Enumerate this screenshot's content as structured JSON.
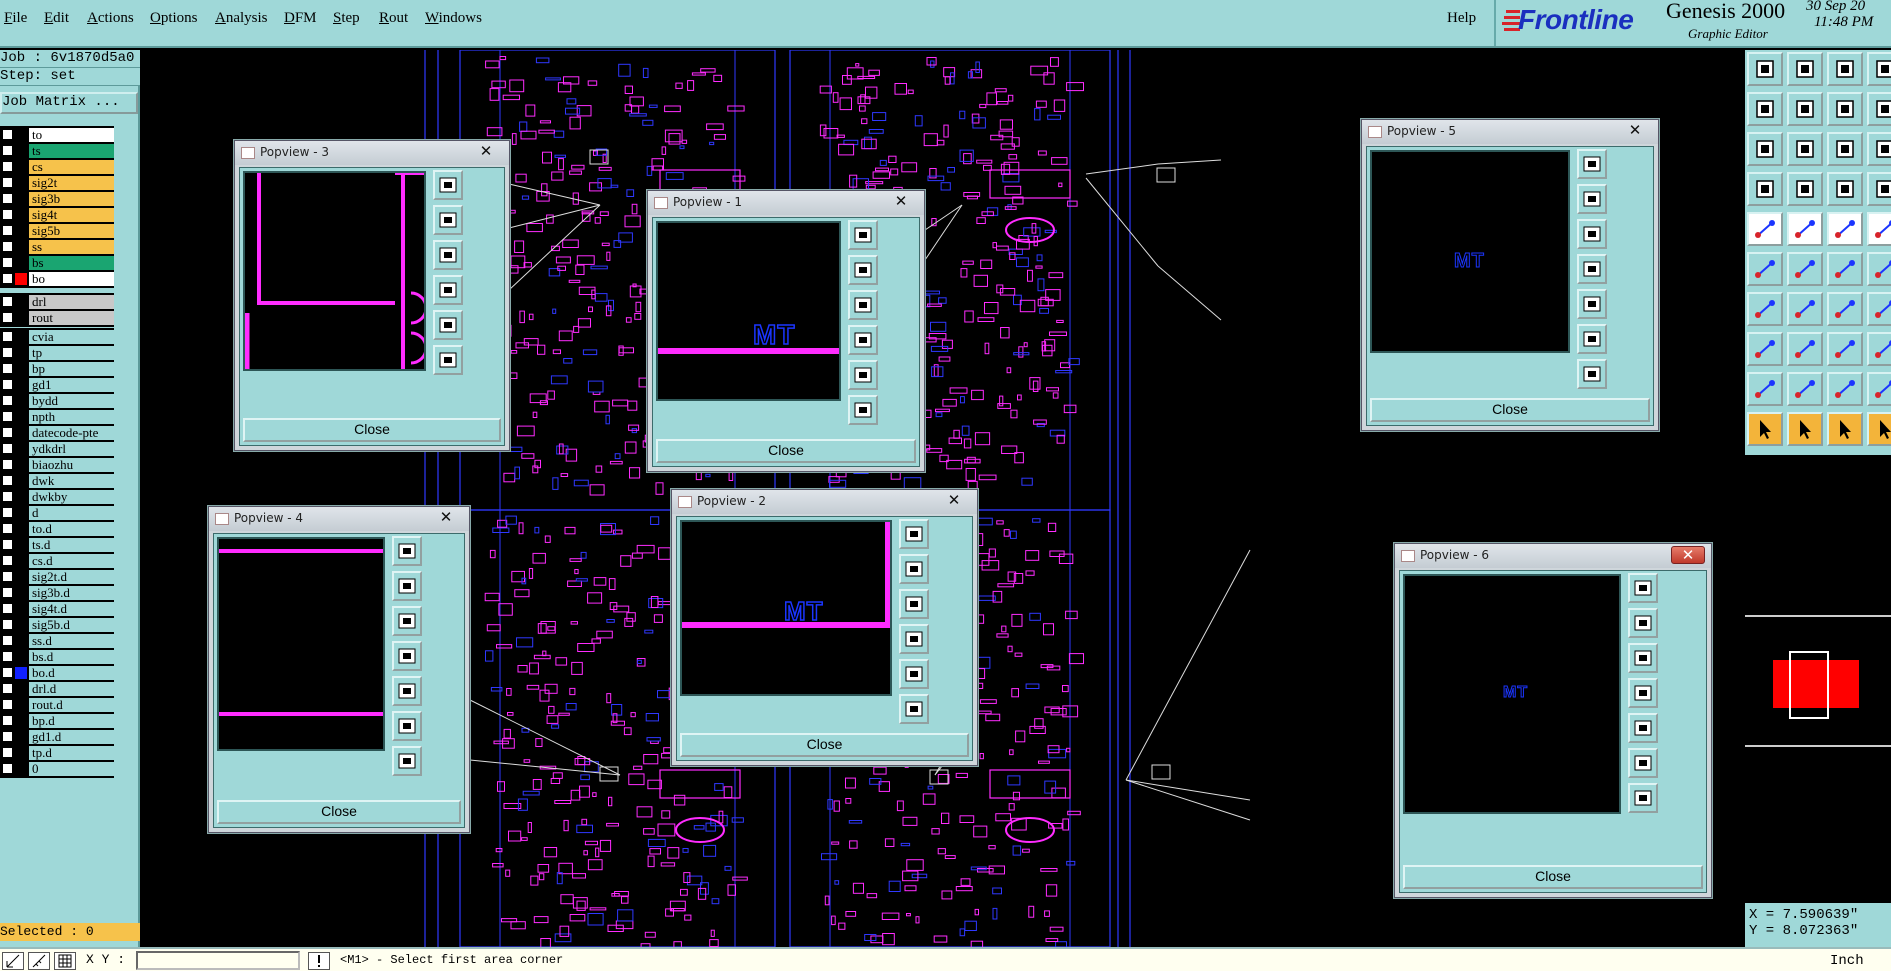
{
  "menubar": {
    "items": [
      "File",
      "Edit",
      "Actions",
      "Options",
      "Analysis",
      "DFM",
      "Step",
      "Rout",
      "Windows"
    ],
    "help": "Help"
  },
  "brand": {
    "logo": "Frontline",
    "title": "Genesis 2000",
    "subtitle": "Graphic Editor",
    "date": "30 Sep 20",
    "time": "11:48 PM"
  },
  "left_panel": {
    "job": "Job : 6v1870d5a0",
    "step": "Step: set",
    "job_matrix": "Job Matrix ...",
    "selected": "Selected : 0",
    "groups": [
      [
        {
          "name": "to",
          "color": "#ffffff",
          "flag": ""
        },
        {
          "name": "ts",
          "color": "#1aa571",
          "flag": ""
        },
        {
          "name": "cs",
          "color": "#f6c24b",
          "flag": ""
        },
        {
          "name": "sig2t",
          "color": "#f6c24b",
          "flag": ""
        },
        {
          "name": "sig3b",
          "color": "#f6c24b",
          "flag": ""
        },
        {
          "name": "sig4t",
          "color": "#f6c24b",
          "flag": ""
        },
        {
          "name": "sig5b",
          "color": "#f6c24b",
          "flag": ""
        },
        {
          "name": "ss",
          "color": "#f6c24b",
          "flag": ""
        },
        {
          "name": "bs",
          "color": "#1aa571",
          "flag": ""
        },
        {
          "name": "bo",
          "color": "#ffffff",
          "flag": "#ff0000"
        }
      ],
      [
        {
          "name": "drl",
          "color": "#c8c8c8",
          "flag": ""
        },
        {
          "name": "rout",
          "color": "#c8c8c8",
          "flag": ""
        }
      ],
      [
        {
          "name": "cvia",
          "color": "#9fd8d8",
          "flag": ""
        },
        {
          "name": "tp",
          "color": "#9fd8d8",
          "flag": ""
        },
        {
          "name": "bp",
          "color": "#9fd8d8",
          "flag": ""
        },
        {
          "name": "gd1",
          "color": "#9fd8d8",
          "flag": ""
        },
        {
          "name": "bydd",
          "color": "#9fd8d8",
          "flag": ""
        },
        {
          "name": "npth",
          "color": "#9fd8d8",
          "flag": ""
        },
        {
          "name": "datecode-pte",
          "color": "#9fd8d8",
          "flag": ""
        },
        {
          "name": "ydkdrl",
          "color": "#9fd8d8",
          "flag": ""
        },
        {
          "name": "biaozhu",
          "color": "#9fd8d8",
          "flag": ""
        },
        {
          "name": "dwk",
          "color": "#9fd8d8",
          "flag": ""
        },
        {
          "name": "dwkby",
          "color": "#9fd8d8",
          "flag": ""
        },
        {
          "name": "d",
          "color": "#9fd8d8",
          "flag": ""
        },
        {
          "name": "to.d",
          "color": "#9fd8d8",
          "flag": ""
        },
        {
          "name": "ts.d",
          "color": "#9fd8d8",
          "flag": ""
        },
        {
          "name": "cs.d",
          "color": "#9fd8d8",
          "flag": ""
        },
        {
          "name": "sig2t.d",
          "color": "#9fd8d8",
          "flag": ""
        },
        {
          "name": "sig3b.d",
          "color": "#9fd8d8",
          "flag": ""
        },
        {
          "name": "sig4t.d",
          "color": "#9fd8d8",
          "flag": ""
        },
        {
          "name": "sig5b.d",
          "color": "#9fd8d8",
          "flag": ""
        },
        {
          "name": "ss.d",
          "color": "#9fd8d8",
          "flag": ""
        },
        {
          "name": "bs.d",
          "color": "#9fd8d8",
          "flag": ""
        },
        {
          "name": "bo.d",
          "color": "#9fd8d8",
          "flag": "#1020ff"
        },
        {
          "name": "drl.d",
          "color": "#9fd8d8",
          "flag": ""
        },
        {
          "name": "rout.d",
          "color": "#9fd8d8",
          "flag": ""
        },
        {
          "name": "bp.d",
          "color": "#9fd8d8",
          "flag": ""
        },
        {
          "name": "gd1.d",
          "color": "#9fd8d8",
          "flag": ""
        },
        {
          "name": "tp.d",
          "color": "#9fd8d8",
          "flag": ""
        },
        {
          "name": "0",
          "color": "#9fd8d8",
          "flag": ""
        }
      ]
    ]
  },
  "popviews": [
    {
      "title": "Popview - 3",
      "close": "Close",
      "label": ""
    },
    {
      "title": "Popview - 1",
      "close": "Close",
      "label": "MT"
    },
    {
      "title": "Popview - 5",
      "close": "Close",
      "label": "MT"
    },
    {
      "title": "Popview - 4",
      "close": "Close",
      "label": ""
    },
    {
      "title": "Popview - 2",
      "close": "Close",
      "label": "MT"
    },
    {
      "title": "Popview - 6",
      "close": "Close",
      "label": "MT"
    }
  ],
  "coords": {
    "x": "X = 7.590639\"",
    "y": "Y = 8.072363\""
  },
  "statusbar": {
    "xy_label": "X Y :",
    "xy_value": "",
    "prompt": "<M1> - Select first area corner",
    "units": "Inch"
  },
  "colors": {
    "panel": "#9fd8d8",
    "trace_magenta": "#ff2cff",
    "outline_blue": "#2f38ff",
    "selected_orange": "#f6c24b"
  }
}
